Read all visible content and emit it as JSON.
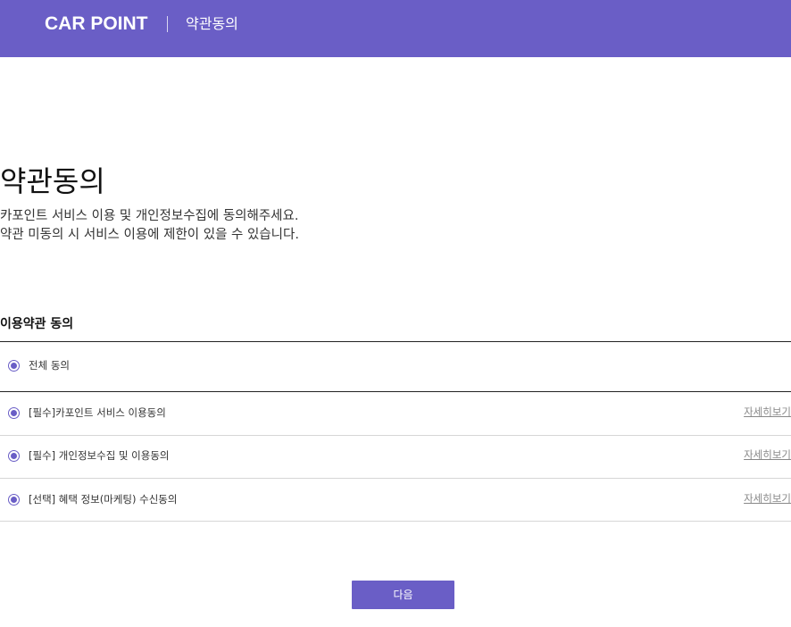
{
  "header": {
    "brand": "CAR POINT",
    "title": "약관동의"
  },
  "main": {
    "heading": "약관동의",
    "description_lines": [
      "카포인트 서비스 이용 및 개인정보수집에 동의해주세요.",
      "약관 미동의 시 서비스 이용에 제한이 있을 수 있습니다."
    ],
    "section_title": "이용약관 동의"
  },
  "terms": {
    "all": {
      "label": "전체 동의",
      "checked": true
    },
    "items": [
      {
        "label": "[필수]카포인트 서비스 이용동의",
        "detail": "자세히보기",
        "checked": true
      },
      {
        "label": "[필수] 개인정보수집 및 이용동의",
        "detail": "자세히보기",
        "checked": true
      },
      {
        "label": "[선택] 혜택 정보(마케팅) 수신동의",
        "detail": "자세히보기",
        "checked": true
      }
    ]
  },
  "footer": {
    "next_label": "다음"
  },
  "colors": {
    "accent": "#6a5ec6",
    "header_bg": "#6a5ec6"
  }
}
